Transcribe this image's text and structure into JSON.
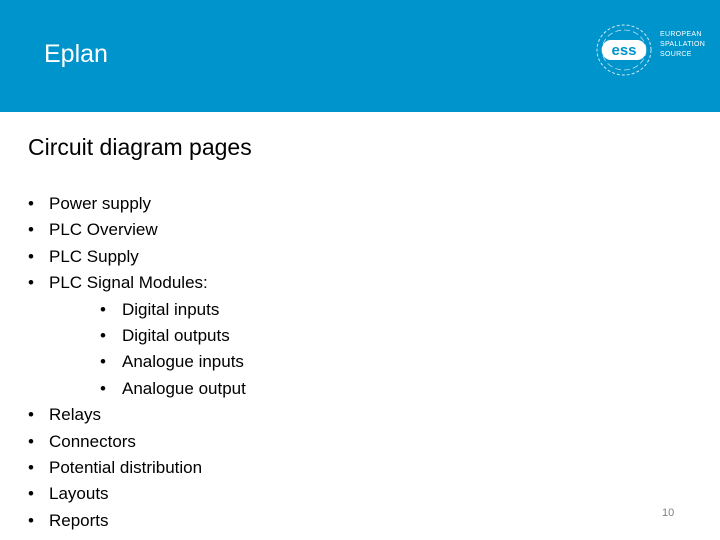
{
  "header": {
    "title": "Eplan",
    "background_color": "#0094cc",
    "logo": {
      "mark": "ess",
      "lines": [
        "EUROPEAN",
        "SPALLATION",
        "SOURCE"
      ]
    }
  },
  "slide": {
    "title": "Circuit diagram pages",
    "items": [
      {
        "label": "Power supply",
        "level": 1
      },
      {
        "label": "PLC Overview",
        "level": 1
      },
      {
        "label": "PLC Supply",
        "level": 1
      },
      {
        "label": "PLC Signal Modules:",
        "level": 1
      },
      {
        "label": "Digital inputs",
        "level": 2
      },
      {
        "label": "Digital outputs",
        "level": 2
      },
      {
        "label": "Analogue inputs",
        "level": 2
      },
      {
        "label": "Analogue output",
        "level": 2
      },
      {
        "label": "Relays",
        "level": 1
      },
      {
        "label": "Connectors",
        "level": 1
      },
      {
        "label": "Potential distribution",
        "level": 1
      },
      {
        "label": "Layouts",
        "level": 1
      },
      {
        "label": "Reports",
        "level": 1
      }
    ],
    "bullet_glyph": "•"
  },
  "footer": {
    "page_number": "10"
  }
}
